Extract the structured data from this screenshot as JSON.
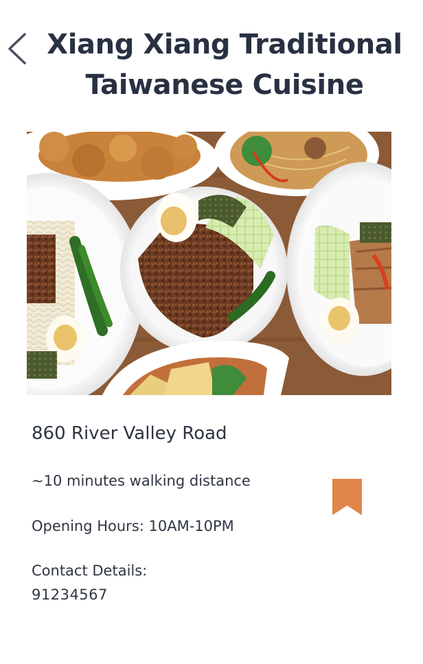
{
  "header": {
    "back_icon": "chevron-left-icon",
    "title_line1": "Xiang Xiang Traditional",
    "title_line2": "Taiwanese Cuisine"
  },
  "hero_image": {
    "description_icon": "food-photo"
  },
  "details": {
    "address": "860 River Valley Road",
    "walking_distance": "~10 minutes walking distance",
    "opening_hours": "Opening Hours: 10AM-10PM",
    "contact_label": "Contact Details:",
    "contact_number": "91234567"
  },
  "bookmark": {
    "icon": "bookmark-icon",
    "color": "#e0864a"
  },
  "colors": {
    "text": "#2f3542",
    "title": "#283142",
    "back_icon": "#4a5060"
  }
}
